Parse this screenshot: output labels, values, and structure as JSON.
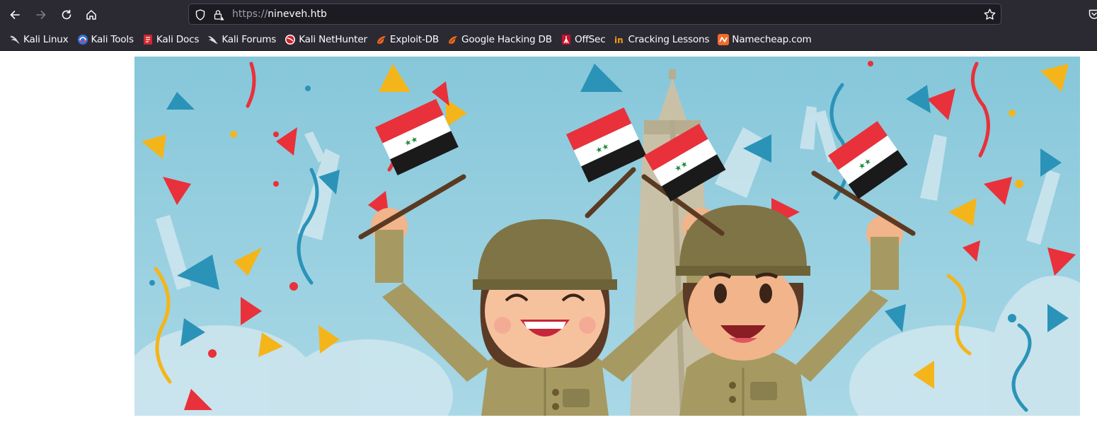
{
  "browser": {
    "url_scheme": "https://",
    "url_host": "nineveh.htb"
  },
  "bookmarks": [
    {
      "label": "Kali Linux",
      "icon": "kali-dragon-icon"
    },
    {
      "label": "Kali Tools",
      "icon": "kali-tools-icon"
    },
    {
      "label": "Kali Docs",
      "icon": "kali-docs-icon"
    },
    {
      "label": "Kali Forums",
      "icon": "kali-forums-icon"
    },
    {
      "label": "Kali NetHunter",
      "icon": "nethunter-icon"
    },
    {
      "label": "Exploit-DB",
      "icon": "exploit-db-icon"
    },
    {
      "label": "Google Hacking DB",
      "icon": "ghdb-icon"
    },
    {
      "label": "OffSec",
      "icon": "offsec-icon"
    },
    {
      "label": "Cracking Lessons",
      "icon": "cracking-lessons-icon"
    },
    {
      "label": "Namecheap.com",
      "icon": "namecheap-icon"
    }
  ],
  "colors": {
    "chrome_bg": "#2b2a33",
    "urlbar_bg": "#1c1b22",
    "banner_sky": "#8fcbdc",
    "helmet": "#7f7446",
    "uniform": "#a69a62",
    "flag_red": "#e8313a",
    "flag_black": "#1a1a1a",
    "flag_green": "#1e8a3a"
  },
  "banner": {
    "image": "celebration-illustration"
  }
}
